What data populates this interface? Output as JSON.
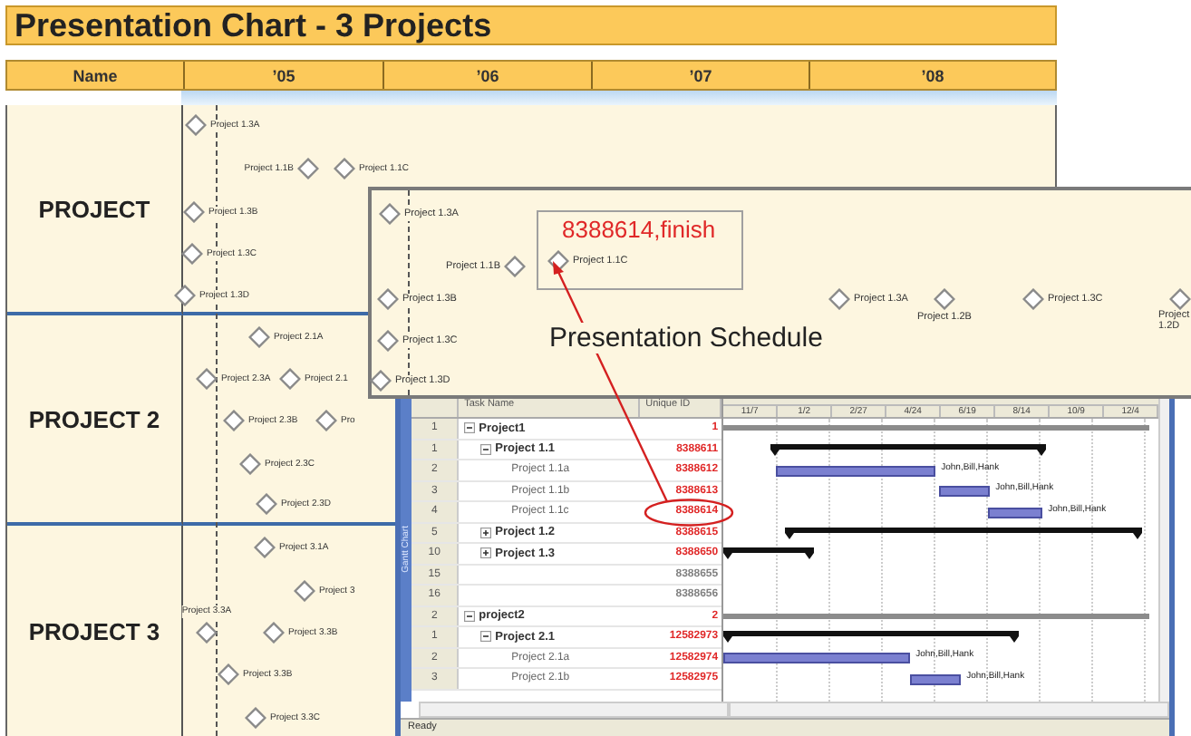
{
  "chart": {
    "title": "Presentation Chart - 3 Projects",
    "name_header": "Name",
    "years": [
      "’05",
      "’06",
      "’07",
      "’08"
    ],
    "rows": [
      {
        "name": "PROJECT",
        "milestones": [
          {
            "label": "Project 1.3A"
          },
          {
            "label": "Project 1.1B"
          },
          {
            "label": "Project 1.1C"
          },
          {
            "label": "Project 1.3B"
          },
          {
            "label": "Project 1.3C"
          },
          {
            "label": "Project 1.3D"
          }
        ]
      },
      {
        "name": "PROJECT 2",
        "milestones": [
          {
            "label": "Project 2.1A"
          },
          {
            "label": "Project 2.3A"
          },
          {
            "label": "Project 2.1"
          },
          {
            "label": "Project 2.3B"
          },
          {
            "label": "Pro"
          },
          {
            "label": "Project 2.3C"
          },
          {
            "label": "Project 2.3D"
          }
        ]
      },
      {
        "name": "PROJECT 3",
        "milestones": [
          {
            "label": "Project 3.1A"
          },
          {
            "label": "Project 3"
          },
          {
            "label": "Project 3.3A"
          },
          {
            "label": "Project 3.3B"
          },
          {
            "label": "Project 3.3B"
          },
          {
            "label": "Project 3.3C"
          }
        ]
      }
    ]
  },
  "schedule_panel": {
    "title": "Presentation Schedule",
    "callout": "8388614,finish",
    "milestones": [
      {
        "label": "Project 1.3A"
      },
      {
        "label": "Project 1.1B"
      },
      {
        "label": "Project 1.1C"
      },
      {
        "label": "Project 1.3B"
      },
      {
        "label": "Project 1.3C"
      },
      {
        "label": "Project 1.3D"
      },
      {
        "label": "Project 1.3A"
      },
      {
        "label": "Project 1.2B"
      },
      {
        "label": "Project 1.3C"
      },
      {
        "label": "Project 1.2D"
      }
    ]
  },
  "project_window": {
    "view_bar": "Gantt Chart",
    "columns": [
      "Task Name",
      "Unique ID"
    ],
    "timescale": [
      "11/7",
      "1/2",
      "2/27",
      "4/24",
      "6/19",
      "8/14",
      "10/9",
      "12/4"
    ],
    "tasks": [
      {
        "num": "1",
        "name": "Project1",
        "uid": "1",
        "color": "#e02828",
        "kind": "project",
        "expanded": true,
        "children": [
          {
            "num": "1",
            "name": "Project 1.1",
            "uid": "8388611",
            "color": "#e02828",
            "kind": "summary",
            "expanded": true,
            "children": [
              {
                "num": "2",
                "name": "Project 1.1a",
                "uid": "8388612",
                "color": "#e02828",
                "kind": "task",
                "resources": "John,Bill,Hank"
              },
              {
                "num": "3",
                "name": "Project 1.1b",
                "uid": "8388613",
                "color": "#e02828",
                "kind": "task",
                "resources": "John,Bill,Hank"
              },
              {
                "num": "4",
                "name": "Project 1.1c",
                "uid": "8388614",
                "color": "#e02828",
                "kind": "task",
                "resources": "John,Bill,Hank",
                "highlighted": true
              }
            ]
          },
          {
            "num": "5",
            "name": "Project 1.2",
            "uid": "8388615",
            "color": "#e02828",
            "kind": "summary",
            "expanded": false
          },
          {
            "num": "10",
            "name": "Project 1.3",
            "uid": "8388650",
            "color": "#e02828",
            "kind": "summary",
            "expanded": false
          },
          {
            "num": "15",
            "uid": "8388655",
            "color": "#808080",
            "kind": "blank"
          },
          {
            "num": "16",
            "uid": "8388656",
            "color": "#808080",
            "kind": "blank"
          }
        ]
      },
      {
        "num": "2",
        "name": "project2",
        "uid": "2",
        "color": "#e02828",
        "kind": "project",
        "expanded": true,
        "children": [
          {
            "num": "1",
            "name": "Project 2.1",
            "uid": "12582973",
            "color": "#e02828",
            "kind": "summary",
            "expanded": true,
            "children": [
              {
                "num": "2",
                "name": "Project 2.1a",
                "uid": "12582974",
                "color": "#e02828",
                "kind": "task",
                "resources": "John,Bill,Hank"
              },
              {
                "num": "3",
                "name": "Project 2.1b",
                "uid": "12582975",
                "color": "#e02828",
                "kind": "task",
                "resources": "John,Bill,Hank"
              }
            ]
          }
        ]
      }
    ],
    "status": "Ready"
  }
}
